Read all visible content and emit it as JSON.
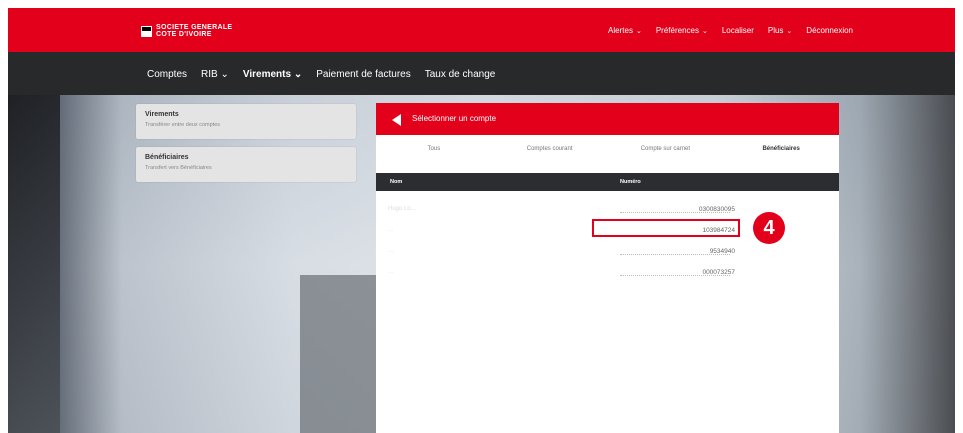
{
  "brand": {
    "line1": "SOCIETE GENERALE",
    "line2": "COTE D'IVOIRE"
  },
  "topnav": {
    "alertes": "Alertes",
    "preferences": "Préférences",
    "localiser": "Localiser",
    "plus": "Plus",
    "deconnexion": "Déconnexion"
  },
  "subnav": {
    "comptes": "Comptes",
    "rib": "RIB",
    "virements": "Virements",
    "paiement": "Paiement de factures",
    "taux": "Taux de change"
  },
  "side_cards": [
    {
      "title": "Virements",
      "subtitle": "Transférer entre deux comptes"
    },
    {
      "title": "Bénéficiaires",
      "subtitle": "Transfert vers Bénéficiaires"
    }
  ],
  "panel": {
    "title": "Sélectionner un compte",
    "tabs": [
      "Tous",
      "Comptes courant",
      "Compte sur carnet",
      "Bénéficiaires"
    ],
    "columns": {
      "name": "Nom",
      "number": "Numéro"
    },
    "rows": [
      {
        "name": "Hugo Lo...",
        "number": "0300830095"
      },
      {
        "name": "...",
        "number": "103984724"
      },
      {
        "name": "...",
        "number": "9534940"
      },
      {
        "name": "...",
        "number": "000073257"
      }
    ]
  },
  "step_badge": "4",
  "colors": {
    "brand_red": "#e2001a",
    "dark": "#27292b"
  }
}
